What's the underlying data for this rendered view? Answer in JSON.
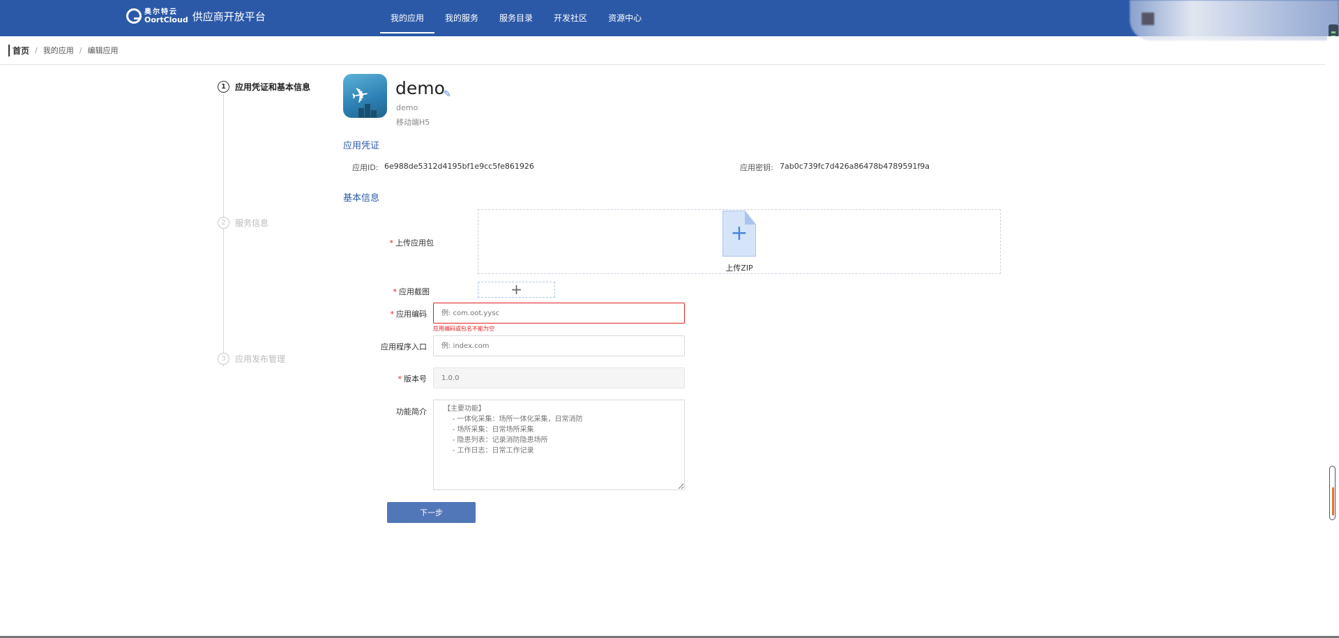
{
  "header": {
    "logo_cn": "奥尔特云",
    "logo_en": "OortCloud",
    "platform_name": "供应商开放平台",
    "nav": [
      {
        "label": "我的应用",
        "active": true
      },
      {
        "label": "我的服务",
        "active": false
      },
      {
        "label": "服务目录",
        "active": false
      },
      {
        "label": "开发社区",
        "active": false
      },
      {
        "label": "资源中心",
        "active": false
      }
    ]
  },
  "breadcrumb": {
    "home": "首页",
    "items": [
      "我的应用",
      "编辑应用"
    ],
    "separator": "/"
  },
  "steps": [
    {
      "number": "1",
      "label": "应用凭证和基本信息",
      "active": true
    },
    {
      "number": "2",
      "label": "服务信息",
      "active": false
    },
    {
      "number": "3",
      "label": "应用发布管理",
      "active": false
    }
  ],
  "app": {
    "name": "demo",
    "code": "demo",
    "type": "移动端H5"
  },
  "credentials": {
    "section_title": "应用凭证",
    "app_id_label": "应用ID:",
    "app_id": "6e988de5312d4195bf1e9cc5fe861926",
    "secret_label": "应用密钥:",
    "secret": "7ab0c739fc7d426a86478b4789591f9a"
  },
  "basic_info": {
    "section_title": "基本信息",
    "upload_package_label": "上传应用包",
    "upload_zip_text": "上传ZIP",
    "screenshot_label": "应用截图",
    "screenshot_plus": "+",
    "app_code_label": "应用编码",
    "app_code_placeholder": "例: com.oot.yysc",
    "app_code_error": "应用编码或包名不能为空",
    "entry_label": "应用程序入口",
    "entry_placeholder": "例: index.com",
    "version_label": "版本号",
    "version_placeholder": "1.0.0",
    "desc_label": "功能简介",
    "desc_placeholder": "【主要功能】\n    - 一体化采集：场所一体化采集，日常消防\n    - 场所采集：日常场所采集\n    - 隐患列表：记录消防隐患场所\n    - 工作日志：日常工作记录",
    "required_mark": "*"
  },
  "actions": {
    "next_label": "下一步"
  },
  "colors": {
    "brand": "#2b59a8",
    "primary_button": "#5177b8",
    "error": "#e02020"
  }
}
